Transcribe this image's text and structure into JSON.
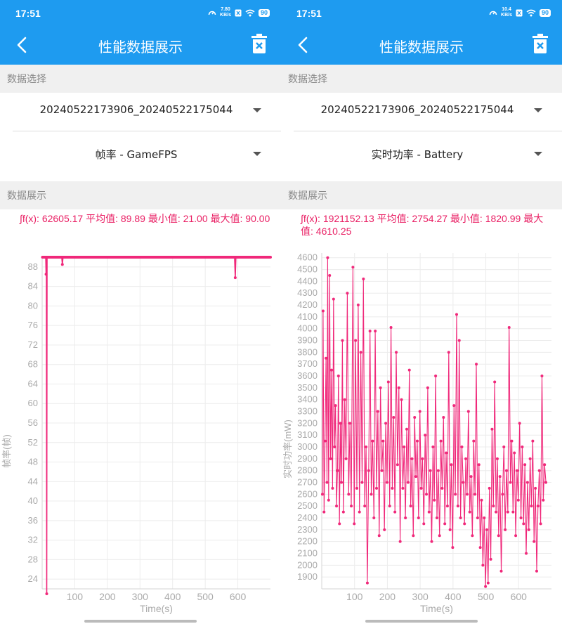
{
  "screens": [
    {
      "status": {
        "time": "17:51",
        "speed_value": "7.80",
        "speed_unit": "KB/s",
        "battery": "90"
      },
      "appbar": {
        "title": "性能数据展示"
      },
      "data_select_label": "数据选择",
      "file_select": {
        "value": "20240522173906_20240522175044"
      },
      "metric_select": {
        "value": "帧率 - GameFPS"
      },
      "display_label": "数据展示",
      "stats": {
        "text": "∫f(x): 62605.17 平均值: 89.89 最小值: 21.00 最大值: 90.00"
      },
      "chart_data": {
        "type": "line",
        "title": "",
        "xlabel": "Time(s)",
        "ylabel": "帧率(帧)",
        "xlim": [
          0,
          700
        ],
        "ylim": [
          22,
          90
        ],
        "x_ticks": [
          100,
          200,
          300,
          400,
          500,
          600
        ],
        "y_ticks": [
          24,
          28,
          32,
          36,
          40,
          44,
          48,
          52,
          56,
          60,
          64,
          68,
          72,
          76,
          80,
          84,
          88
        ],
        "series": [
          {
            "color": "#f0287a",
            "points": [
              [
                1,
                90
              ],
              [
                11,
                90
              ],
              [
                12,
                86.5
              ],
              [
                13,
                90
              ],
              [
                14,
                21
              ],
              [
                15,
                90
              ],
              [
                60,
                90
              ],
              [
                62,
                88.5
              ],
              [
                64,
                90
              ],
              [
                590,
                90
              ],
              [
                592,
                85.8
              ],
              [
                594,
                90
              ],
              [
                700,
                90
              ]
            ]
          }
        ]
      }
    },
    {
      "status": {
        "time": "17:51",
        "speed_value": "10.4",
        "speed_unit": "KB/s",
        "battery": "90"
      },
      "appbar": {
        "title": "性能数据展示"
      },
      "data_select_label": "数据选择",
      "file_select": {
        "value": "20240522173906_20240522175044"
      },
      "metric_select": {
        "value": "实时功率 - Battery"
      },
      "display_label": "数据展示",
      "stats": {
        "text": "∫f(x): 1921152.13 平均值: 2754.27 最小值: 1820.99 最大值: 4610.25"
      },
      "chart_data": {
        "type": "line",
        "title": "",
        "xlabel": "Time(s)",
        "ylabel": "实时功率(mW)",
        "xlim": [
          0,
          700
        ],
        "ylim": [
          1800,
          4640
        ],
        "x_ticks": [
          100,
          200,
          300,
          400,
          500,
          600
        ],
        "y_ticks": [
          1900,
          2000,
          2100,
          2200,
          2300,
          2400,
          2500,
          2600,
          2700,
          2800,
          2900,
          3000,
          3100,
          3200,
          3300,
          3400,
          3500,
          3600,
          3700,
          3800,
          3900,
          4000,
          4100,
          4200,
          4300,
          4400,
          4500,
          4600
        ],
        "series": [
          {
            "color": "#f0287a",
            "points": [
              [
                2,
                2600
              ],
              [
                4,
                4150
              ],
              [
                7,
                2450
              ],
              [
                10,
                3050
              ],
              [
                13,
                3750
              ],
              [
                16,
                2700
              ],
              [
                18,
                4600
              ],
              [
                21,
                2550
              ],
              [
                24,
                4450
              ],
              [
                27,
                2900
              ],
              [
                30,
                3650
              ],
              [
                33,
                2650
              ],
              [
                36,
                4250
              ],
              [
                39,
                3000
              ],
              [
                42,
                3350
              ],
              [
                45,
                2500
              ],
              [
                48,
                2800
              ],
              [
                51,
                3600
              ],
              [
                54,
                2350
              ],
              [
                57,
                3200
              ],
              [
                60,
                2700
              ],
              [
                63,
                3900
              ],
              [
                66,
                2450
              ],
              [
                70,
                3400
              ],
              [
                74,
                2900
              ],
              [
                78,
                4300
              ],
              [
                82,
                2600
              ],
              [
                86,
                3200
              ],
              [
                90,
                2500
              ],
              [
                95,
                4520
              ],
              [
                99,
                2350
              ],
              [
                103,
                3900
              ],
              [
                107,
                2650
              ],
              [
                111,
                4200
              ],
              [
                115,
                2450
              ],
              [
                119,
                3800
              ],
              [
                123,
                2700
              ],
              [
                127,
                4420
              ],
              [
                131,
                2500
              ],
              [
                135,
                3000
              ],
              [
                139,
                1850
              ],
              [
                143,
                2800
              ],
              [
                147,
                3980
              ],
              [
                151,
                2600
              ],
              [
                155,
                3050
              ],
              [
                159,
                2400
              ],
              [
                163,
                3980
              ],
              [
                167,
                2650
              ],
              [
                171,
                3300
              ],
              [
                175,
                2250
              ],
              [
                179,
                3500
              ],
              [
                183,
                2800
              ],
              [
                187,
                3050
              ],
              [
                191,
                2300
              ],
              [
                195,
                3200
              ],
              [
                199,
                2700
              ],
              [
                203,
                3550
              ],
              [
                207,
                2500
              ],
              [
                211,
                4010
              ],
              [
                215,
                2650
              ],
              [
                219,
                3250
              ],
              [
                223,
                2450
              ],
              [
                227,
                3800
              ],
              [
                231,
                2850
              ],
              [
                235,
                3500
              ],
              [
                239,
                2200
              ],
              [
                243,
                3400
              ],
              [
                247,
                2650
              ],
              [
                251,
                3000
              ],
              [
                255,
                2400
              ],
              [
                259,
                3150
              ],
              [
                263,
                2700
              ],
              [
                267,
                3650
              ],
              [
                271,
                2500
              ],
              [
                275,
                2900
              ],
              [
                279,
                2250
              ],
              [
                283,
                3250
              ],
              [
                287,
                2750
              ],
              [
                291,
                3050
              ],
              [
                295,
                2400
              ],
              [
                299,
                3300
              ],
              [
                303,
                2650
              ],
              [
                307,
                2900
              ],
              [
                311,
                2350
              ],
              [
                315,
                3100
              ],
              [
                319,
                2600
              ],
              [
                323,
                3500
              ],
              [
                327,
                2450
              ],
              [
                331,
                2800
              ],
              [
                335,
                2200
              ],
              [
                339,
                3000
              ],
              [
                343,
                2550
              ],
              [
                347,
                3600
              ],
              [
                351,
                2400
              ],
              [
                355,
                2800
              ],
              [
                359,
                2250
              ],
              [
                363,
                3050
              ],
              [
                367,
                2650
              ],
              [
                371,
                3250
              ],
              [
                375,
                2350
              ],
              [
                379,
                2950
              ],
              [
                383,
                2500
              ],
              [
                387,
                3800
              ],
              [
                391,
                2300
              ],
              [
                395,
                2850
              ],
              [
                399,
                2150
              ],
              [
                403,
                3350
              ],
              [
                407,
                2600
              ],
              [
                411,
                4120
              ],
              [
                415,
                2500
              ],
              [
                419,
                3900
              ],
              [
                423,
                2400
              ],
              [
                427,
                3000
              ],
              [
                431,
                2700
              ],
              [
                435,
                2350
              ],
              [
                439,
                2900
              ],
              [
                443,
                2600
              ],
              [
                447,
                3300
              ],
              [
                451,
                2450
              ],
              [
                455,
                2750
              ],
              [
                459,
                2250
              ],
              [
                463,
                3050
              ],
              [
                467,
                2600
              ],
              [
                471,
                3700
              ],
              [
                475,
                2400
              ],
              [
                479,
                2850
              ],
              [
                483,
                2150
              ],
              [
                487,
                2550
              ],
              [
                491,
                2000
              ],
              [
                495,
                2400
              ],
              [
                499,
                1820
              ],
              [
                503,
                2300
              ],
              [
                507,
                1850
              ],
              [
                511,
                2650
              ],
              [
                515,
                2050
              ],
              [
                519,
                3150
              ],
              [
                523,
                2500
              ],
              [
                527,
                3550
              ],
              [
                531,
                2450
              ],
              [
                535,
                2900
              ],
              [
                539,
                2250
              ],
              [
                543,
                2750
              ],
              [
                547,
                1950
              ],
              [
                551,
                2600
              ],
              [
                555,
                3000
              ],
              [
                559,
                2300
              ],
              [
                563,
                2800
              ],
              [
                567,
                2450
              ],
              [
                571,
                4010
              ],
              [
                575,
                2700
              ],
              [
                579,
                3050
              ],
              [
                583,
                2450
              ],
              [
                587,
                2950
              ],
              [
                591,
                2250
              ],
              [
                595,
                2800
              ],
              [
                599,
                2550
              ],
              [
                603,
                3200
              ],
              [
                607,
                2400
              ],
              [
                611,
                3000
              ],
              [
                615,
                2350
              ],
              [
                619,
                2850
              ],
              [
                623,
                2100
              ],
              [
                627,
                2700
              ],
              [
                631,
                2300
              ],
              [
                635,
                2900
              ],
              [
                639,
                2500
              ],
              [
                643,
                3050
              ],
              [
                647,
                2200
              ],
              [
                651,
                2650
              ],
              [
                655,
                1950
              ],
              [
                659,
                2500
              ],
              [
                663,
                2800
              ],
              [
                667,
                2350
              ],
              [
                671,
                3600
              ],
              [
                675,
                2550
              ],
              [
                679,
                2850
              ],
              [
                683,
                2700
              ]
            ]
          }
        ]
      }
    }
  ]
}
